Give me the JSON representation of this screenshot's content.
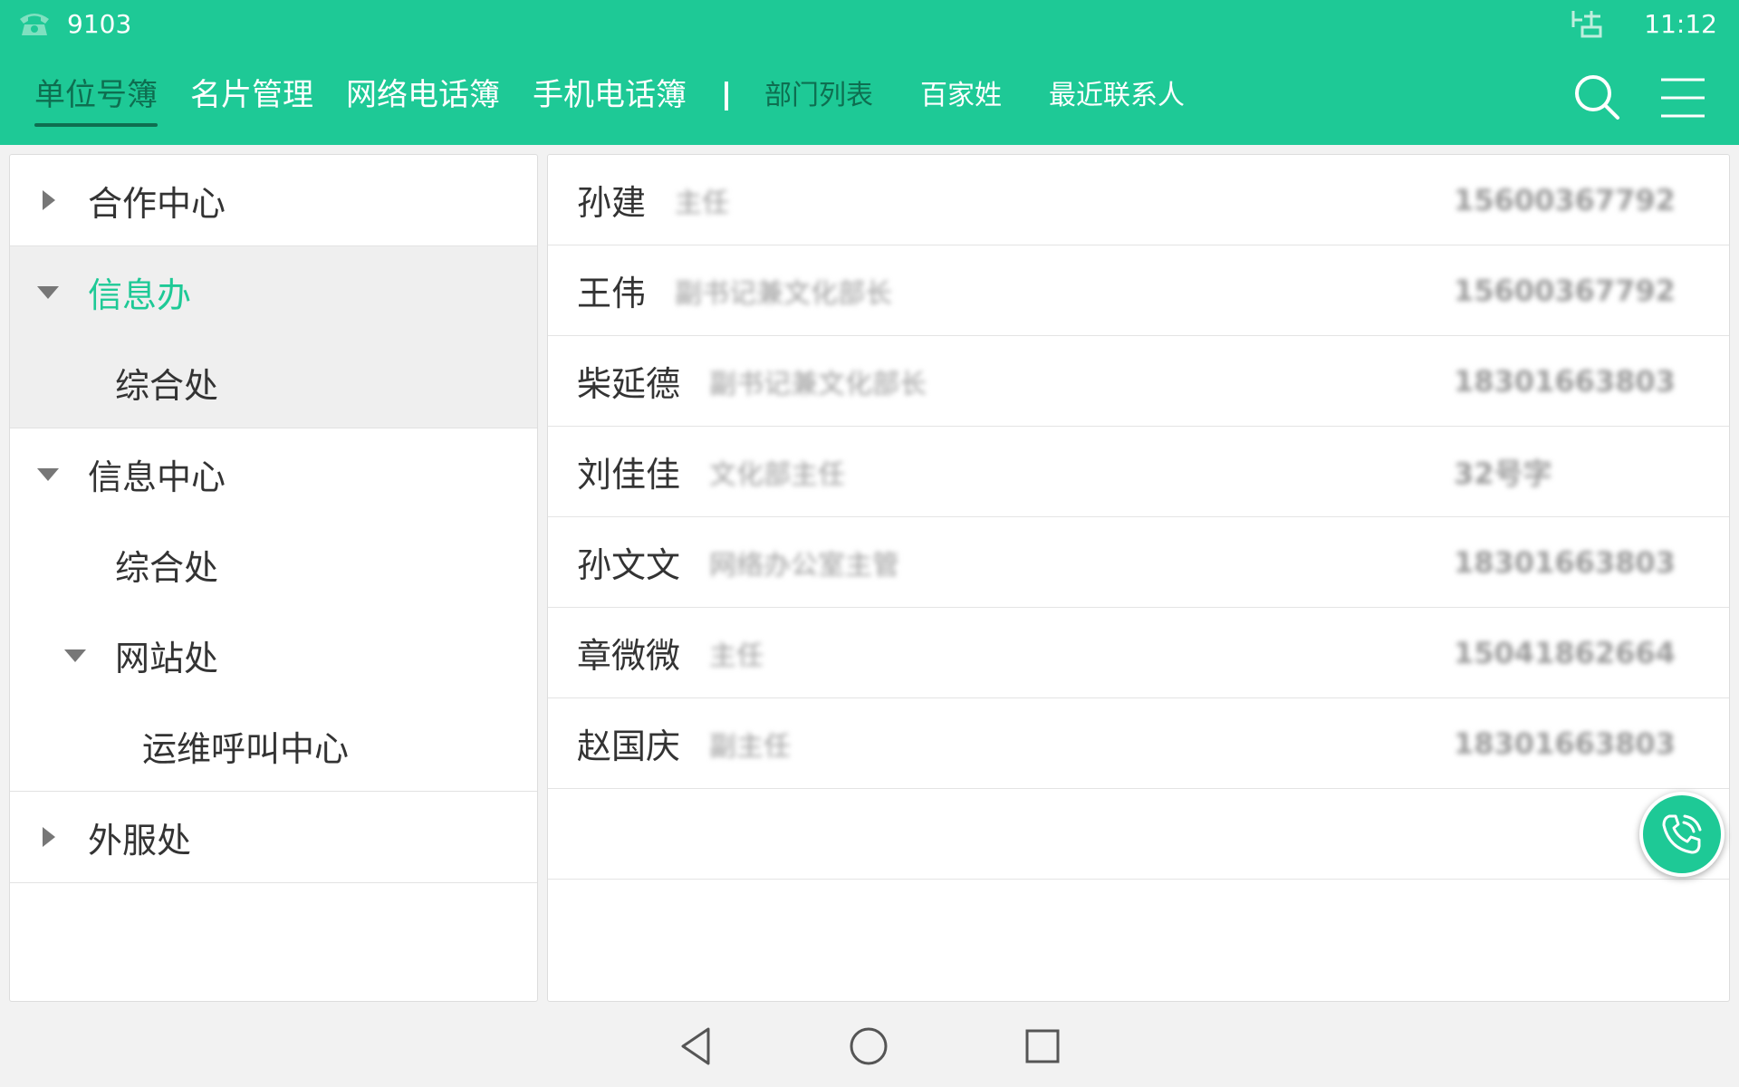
{
  "status": {
    "extension": "9103",
    "time": "11:12",
    "icons": [
      "phone-icon",
      "network-icon"
    ]
  },
  "tabs": {
    "main": [
      "单位号簿",
      "名片管理",
      "网络电话簿",
      "手机电话簿"
    ],
    "sub": [
      "部门列表",
      "百家姓",
      "最近联系人"
    ],
    "active": "单位号簿"
  },
  "tree": {
    "groups": [
      {
        "items": [
          {
            "label": "合作中心",
            "level": 0,
            "state": "collapsed"
          }
        ]
      },
      {
        "items": [
          {
            "label": "信息办",
            "level": 0,
            "state": "expanded",
            "selected": true
          },
          {
            "label": "综合处",
            "level": 1,
            "state": "leaf"
          }
        ]
      },
      {
        "items": [
          {
            "label": "信息中心",
            "level": 0,
            "state": "expanded"
          },
          {
            "label": "综合处",
            "level": 1,
            "state": "leaf"
          },
          {
            "label": "网站处",
            "level": 1,
            "state": "expanded"
          },
          {
            "label": "运维呼叫中心",
            "level": 2,
            "state": "leaf"
          }
        ]
      },
      {
        "items": [
          {
            "label": "外服处",
            "level": 0,
            "state": "collapsed"
          }
        ]
      }
    ]
  },
  "contacts": [
    {
      "name": "孙建",
      "title": "主任",
      "phone": "15600367792"
    },
    {
      "name": "王伟",
      "title": "副书记兼文化部长",
      "phone": "15600367792"
    },
    {
      "name": "柴延德",
      "title": "副书记兼文化部长",
      "phone": "18301663803"
    },
    {
      "name": "刘佳佳",
      "title": "文化部主任",
      "phone": "32号字"
    },
    {
      "name": "孙文文",
      "title": "网络办公室主管",
      "phone": "18301663803"
    },
    {
      "name": "章微微",
      "title": "主任",
      "phone": "15041862664"
    },
    {
      "name": "赵国庆",
      "title": "副主任",
      "phone": "18301663803"
    }
  ],
  "colors": {
    "accent": "#1ec996",
    "active_tab": "#0e6e50",
    "selected_text": "#1ec996"
  }
}
